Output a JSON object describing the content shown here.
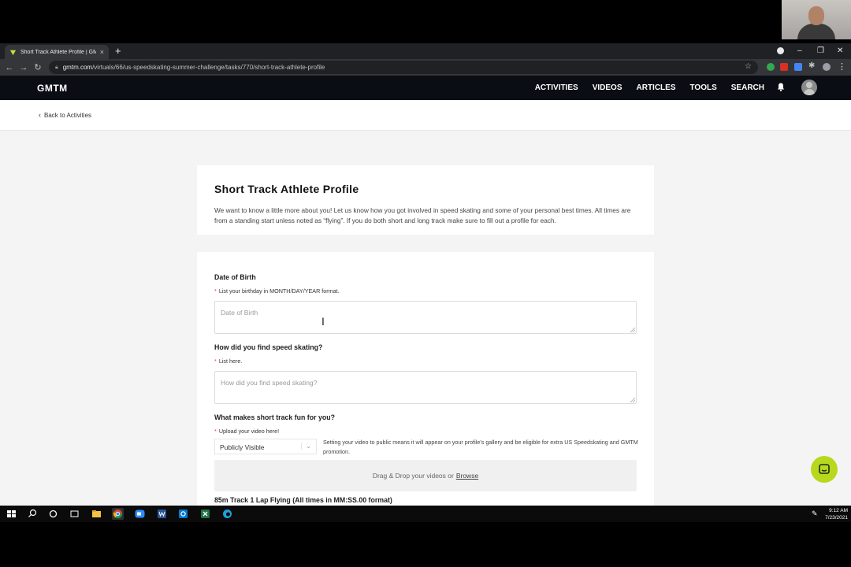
{
  "browser": {
    "tab_title": "Short Track Athlete Profile | GMTM",
    "tab_close": "×",
    "new_tab": "+",
    "url_host": "gmtm.com",
    "url_path": "/virtuals/66/us-speedskating-summer-challenge/tasks/770/short-track-athlete-profile",
    "nav_back": "←",
    "nav_forward": "→",
    "nav_reload": "↻",
    "window_minimize": "–",
    "window_restore": "❐",
    "window_close": "✕",
    "menu": "⋮"
  },
  "site": {
    "logo": "GMTM",
    "nav": [
      "ACTIVITIES",
      "VIDEOS",
      "ARTICLES",
      "TOOLS",
      "SEARCH"
    ],
    "back_label": "Back to Activities"
  },
  "intro": {
    "title": "Short Track Athlete Profile",
    "description": "We want to know a little more about you! Let us know how you got involved in speed skating and some of your personal best times. All times are from a standing start unless noted as “flying”. If you do both short and long track make sure to fill out a profile for each."
  },
  "form": {
    "q1": {
      "label": "Date of Birth",
      "required_mark": "*",
      "hint": "List your birthday in MONTH/DAY/YEAR format.",
      "placeholder": "Date of Birth"
    },
    "q2": {
      "label": "How did you find speed skating?",
      "required_mark": "*",
      "hint": "List here.",
      "placeholder": "How did you find speed skating?"
    },
    "q3": {
      "label": "What makes short track fun for you?",
      "required_mark": "*",
      "hint": "Upload your video here!",
      "visibility_selected": "Publicly Visible",
      "visibility_note": "Setting your video to public means it will appear on your profile's gallery and be eligible for extra US Speedskating and GMTM promotion.",
      "drop_text": "Drag & Drop your videos or",
      "browse_label": "Browse"
    },
    "q4": {
      "label": "85m Track 1 Lap Flying (All times in MM:SS.00 format)"
    }
  },
  "taskbar": {
    "time": "9:12 AM",
    "date": "7/23/2021"
  },
  "colors": {
    "site_nav_bg": "#0b0d14",
    "accent_green": "#b8d81d",
    "required_red": "#e53935"
  }
}
